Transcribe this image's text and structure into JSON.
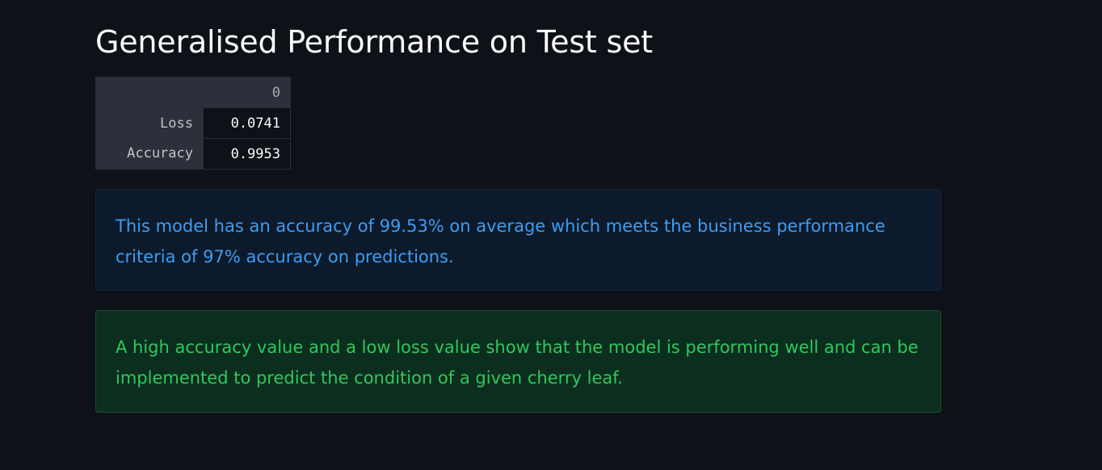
{
  "page": {
    "title": "Generalised Performance on Test set"
  },
  "table": {
    "column_header": "0",
    "rows": [
      {
        "label": "Loss",
        "value": "0.0741"
      },
      {
        "label": "Accuracy",
        "value": "0.9953"
      }
    ]
  },
  "alerts": {
    "info": {
      "text": "This model has an accuracy of 99.53% on average which meets the business performance criteria of 97% accuracy on predictions.",
      "color": "#3d9df3"
    },
    "success": {
      "text": "A high accuracy value and a low loss value show that the model is performing well and can be implemented to predict the condition of a given cherry leaf.",
      "color": "#30c85c"
    }
  },
  "colors": {
    "background": "#0e1117",
    "text": "#fafafa"
  }
}
